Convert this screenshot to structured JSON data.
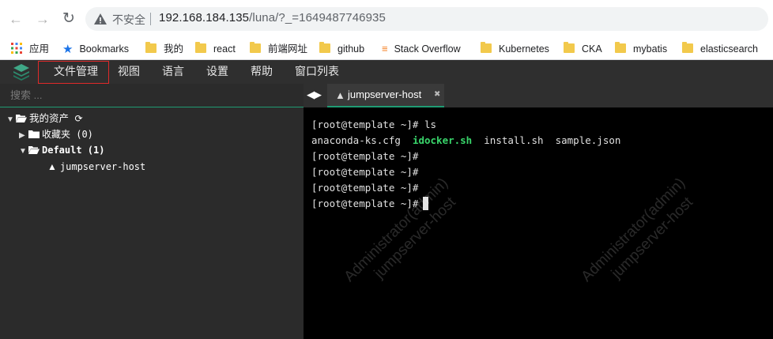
{
  "browser": {
    "insecure_label": "不安全",
    "url_host": "192.168.184.135",
    "url_rest": "/luna/?_=1649487746935"
  },
  "bookmarks": [
    {
      "label": "应用",
      "icon": "apps-icon"
    },
    {
      "label": "Bookmarks",
      "icon": "star-icon"
    },
    {
      "label": "我的",
      "icon": "folder-icon"
    },
    {
      "label": "react",
      "icon": "folder-icon"
    },
    {
      "label": "前端网址",
      "icon": "folder-icon"
    },
    {
      "label": "github",
      "icon": "folder-icon"
    },
    {
      "label": "Stack Overflow",
      "icon": "stackoverflow-icon"
    },
    {
      "label": "Kubernetes",
      "icon": "folder-icon"
    },
    {
      "label": "CKA",
      "icon": "folder-icon"
    },
    {
      "label": "mybatis",
      "icon": "folder-icon"
    },
    {
      "label": "elasticsearch",
      "icon": "folder-icon"
    }
  ],
  "menu": {
    "items": [
      "文件管理",
      "视图",
      "语言",
      "设置",
      "帮助",
      "窗口列表"
    ]
  },
  "sidebar": {
    "search_placeholder": "搜索 ...",
    "tree": {
      "root": "我的资产",
      "favorites": "收藏夹 (0)",
      "default": "Default (1)",
      "host": "jumpserver-host"
    }
  },
  "tabs": {
    "active": "jumpserver-host"
  },
  "terminal": {
    "lines": [
      {
        "prompt": "[root@template ~]#",
        "cmd": " ls"
      },
      {
        "prompt": "[root@template ~]#",
        "cmd": ""
      },
      {
        "prompt": "[root@template ~]#",
        "cmd": ""
      },
      {
        "prompt": "[root@template ~]#",
        "cmd": ""
      },
      {
        "prompt": "[root@template ~]#",
        "cmd": ""
      }
    ],
    "ls_output": {
      "file1": "anaconda-ks.cfg",
      "file2": "idocker.sh",
      "file3": "install.sh",
      "file4": "sample.json"
    },
    "watermark": {
      "line1": "Administrator(admin)",
      "line2": "jumpserver-host"
    }
  },
  "colors": {
    "accent": "#1f9b73",
    "highlight_box": "#e02a2a",
    "exec_green": "#39d66b"
  }
}
